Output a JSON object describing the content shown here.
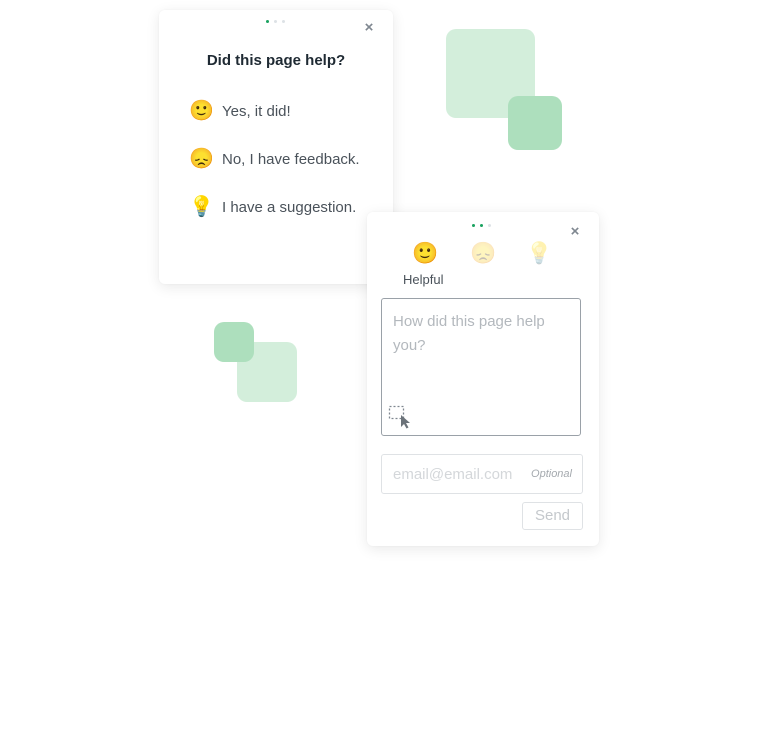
{
  "colors": {
    "accent": "#1aa260",
    "square_light": "#d3eedb",
    "square_mid": "#addfbd"
  },
  "card1": {
    "step_dots": {
      "total": 3,
      "active": 1
    },
    "close_icon": "close-icon",
    "title": "Did this page help?",
    "options": [
      {
        "icon": "slightly-smiling-face-icon",
        "glyph": "🙂",
        "label": "Yes, it did!"
      },
      {
        "icon": "disappointed-face-icon",
        "glyph": "😞",
        "label": "No, I have feedback."
      },
      {
        "icon": "light-bulb-icon",
        "glyph": "💡",
        "label": "I have a suggestion."
      }
    ]
  },
  "card2": {
    "step_dots": {
      "total": 3,
      "active": 2
    },
    "close_icon": "close-icon",
    "emojis": [
      {
        "icon": "slightly-smiling-face-icon",
        "glyph": "🙂",
        "selected": true
      },
      {
        "icon": "disappointed-face-icon",
        "glyph": "😞",
        "selected": false
      },
      {
        "icon": "light-bulb-icon",
        "glyph": "💡",
        "selected": false
      }
    ],
    "selected_label": "Helpful",
    "textarea_placeholder": "How did this page help you?",
    "screenshot_icon": "screenshot-select-icon",
    "email_placeholder": "email@email.com",
    "email_optional": "Optional",
    "send_label": "Send"
  }
}
